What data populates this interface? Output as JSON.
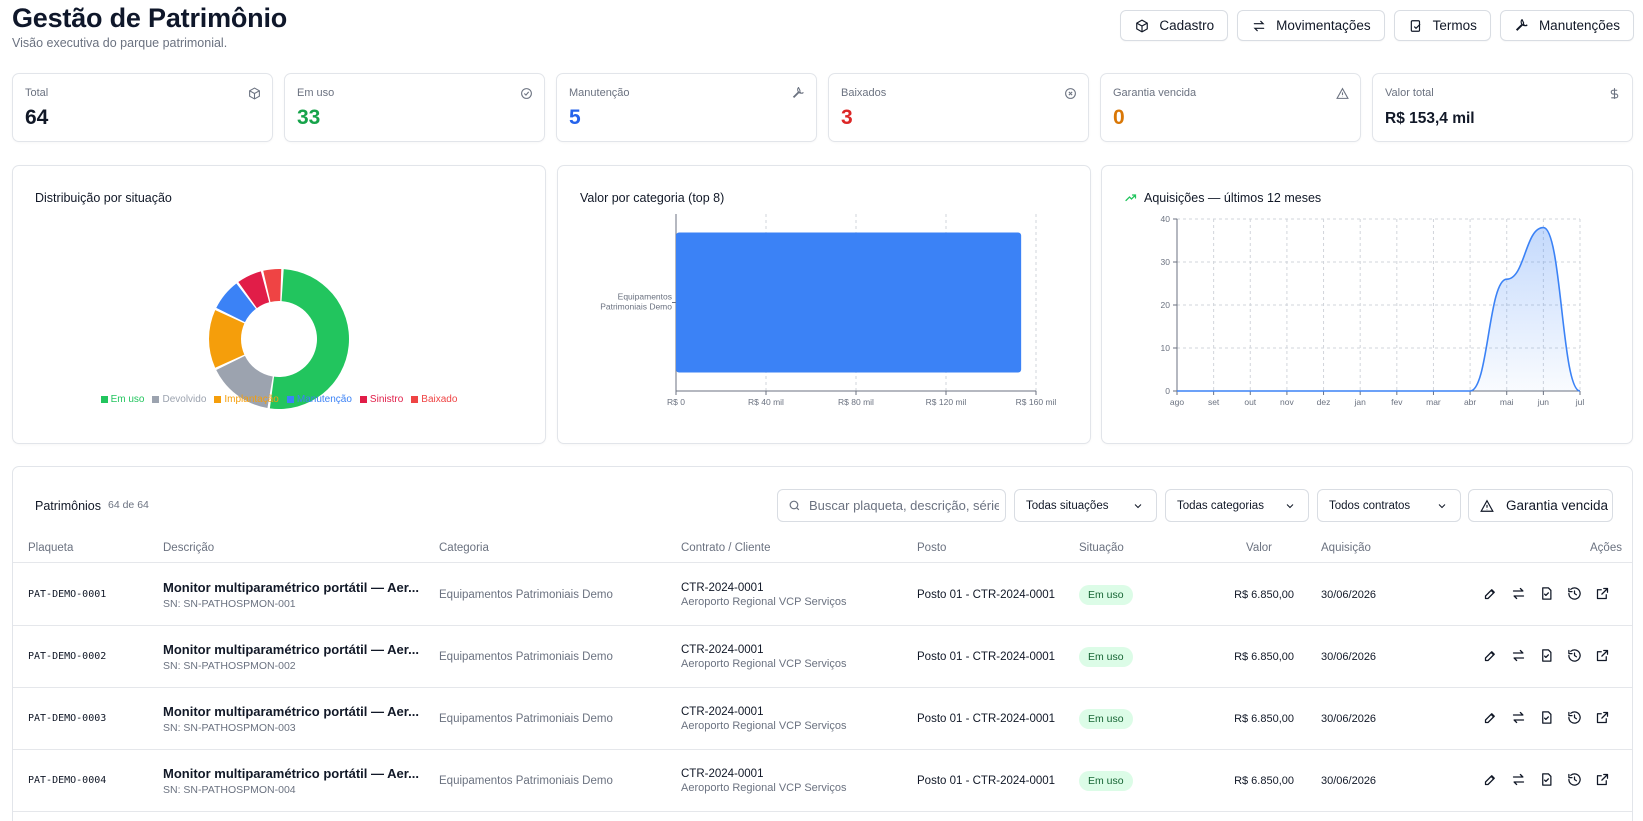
{
  "header": {
    "title": "Gestão de Patrimônio",
    "subtitle": "Visão executiva do parque patrimonial.",
    "buttons": [
      {
        "label": "Cadastro",
        "icon": "box-icon"
      },
      {
        "label": "Movimentações",
        "icon": "arrows-icon"
      },
      {
        "label": "Termos",
        "icon": "document-icon"
      },
      {
        "label": "Manutenções",
        "icon": "wrench-icon"
      }
    ]
  },
  "kpis": [
    {
      "label": "Total",
      "value": "64",
      "color": "#111827",
      "icon": "box-icon"
    },
    {
      "label": "Em uso",
      "value": "33",
      "color": "#16a34a",
      "icon": "check-circle-icon"
    },
    {
      "label": "Manutenção",
      "value": "5",
      "color": "#2563eb",
      "icon": "wrench-icon"
    },
    {
      "label": "Baixados",
      "value": "3",
      "color": "#dc2626",
      "icon": "x-circle-icon"
    },
    {
      "label": "Garantia vencida",
      "value": "0",
      "color": "#d97706",
      "icon": "warning-icon"
    },
    {
      "label": "Valor total",
      "value": "R$ 153,4 mil",
      "color": "#111827",
      "icon": "dollar-icon"
    }
  ],
  "donut_panel": {
    "title": "Distribuição por situação"
  },
  "bar_panel": {
    "title": "Valor por categoria (top 8)"
  },
  "line_panel": {
    "title": "Aquisições — últimos 12 meses"
  },
  "chart_data": [
    {
      "type": "pie",
      "title": "Distribuição por situação",
      "categories": [
        "Em uso",
        "Devolvido",
        "Implantação",
        "Manutenção",
        "Sinistro",
        "Baixado"
      ],
      "values": [
        33,
        10,
        9,
        5,
        4,
        3
      ],
      "colors": [
        "#22c55e",
        "#9ca3af",
        "#f59e0b",
        "#3b82f6",
        "#e11d48",
        "#ef4444"
      ],
      "legend": "bottom"
    },
    {
      "type": "bar",
      "orientation": "horizontal",
      "title": "Valor por categoria (top 8)",
      "categories": [
        "Equipamentos Patrimoniais Demo"
      ],
      "values": [
        153400
      ],
      "xlim": [
        0,
        160000
      ],
      "xticks": [
        "R$ 0",
        "R$ 40 mil",
        "R$ 80 mil",
        "R$ 120 mil",
        "R$ 160 mil"
      ],
      "color": "#3b82f6",
      "grid": true
    },
    {
      "type": "area",
      "title": "Aquisições — últimos 12 meses",
      "x": [
        "ago",
        "set",
        "out",
        "nov",
        "dez",
        "jan",
        "fev",
        "mar",
        "abr",
        "mai",
        "jun",
        "jul"
      ],
      "values": [
        0,
        0,
        0,
        0,
        0,
        0,
        0,
        0,
        0,
        26,
        38,
        0
      ],
      "ylim": [
        0,
        40
      ],
      "yticks": [
        "0",
        "10",
        "20",
        "30",
        "40"
      ],
      "color": "#3b82f6",
      "grid": true
    }
  ],
  "table": {
    "title": "Patrimônios",
    "count": "64 de 64",
    "search_placeholder": "Buscar plaqueta, descrição, série, c",
    "filters": [
      "Todas situações",
      "Todas categorias",
      "Todos contratos"
    ],
    "warranty_label": "Garantia vencida",
    "columns": [
      "Plaqueta",
      "Descrição",
      "Categoria",
      "Contrato / Cliente",
      "Posto",
      "Situação",
      "Valor",
      "Aquisição",
      "Ações"
    ],
    "rows": [
      {
        "plaqueta": "PAT-DEMO-0001",
        "descricao": "Monitor multiparamétrico portátil — Aer...",
        "serie": "SN: SN-PATHOSPMON-001",
        "categoria": "Equipamentos Patrimoniais Demo",
        "contrato": "CTR-2024-0001",
        "cliente": "Aeroporto Regional VCP Serviços",
        "posto": "Posto 01 - CTR-2024-0001",
        "situacao": "Em uso",
        "valor": "R$ 6.850,00",
        "aquisicao": "30/06/2026"
      },
      {
        "plaqueta": "PAT-DEMO-0002",
        "descricao": "Monitor multiparamétrico portátil — Aer...",
        "serie": "SN: SN-PATHOSPMON-002",
        "categoria": "Equipamentos Patrimoniais Demo",
        "contrato": "CTR-2024-0001",
        "cliente": "Aeroporto Regional VCP Serviços",
        "posto": "Posto 01 - CTR-2024-0001",
        "situacao": "Em uso",
        "valor": "R$ 6.850,00",
        "aquisicao": "30/06/2026"
      },
      {
        "plaqueta": "PAT-DEMO-0003",
        "descricao": "Monitor multiparamétrico portátil — Aer...",
        "serie": "SN: SN-PATHOSPMON-003",
        "categoria": "Equipamentos Patrimoniais Demo",
        "contrato": "CTR-2024-0001",
        "cliente": "Aeroporto Regional VCP Serviços",
        "posto": "Posto 01 - CTR-2024-0001",
        "situacao": "Em uso",
        "valor": "R$ 6.850,00",
        "aquisicao": "30/06/2026"
      },
      {
        "plaqueta": "PAT-DEMO-0004",
        "descricao": "Monitor multiparamétrico portátil — Aer...",
        "serie": "SN: SN-PATHOSPMON-004",
        "categoria": "Equipamentos Patrimoniais Demo",
        "contrato": "CTR-2024-0001",
        "cliente": "Aeroporto Regional VCP Serviços",
        "posto": "Posto 01 - CTR-2024-0001",
        "situacao": "Em uso",
        "valor": "R$ 6.850,00",
        "aquisicao": "30/06/2026"
      }
    ]
  }
}
